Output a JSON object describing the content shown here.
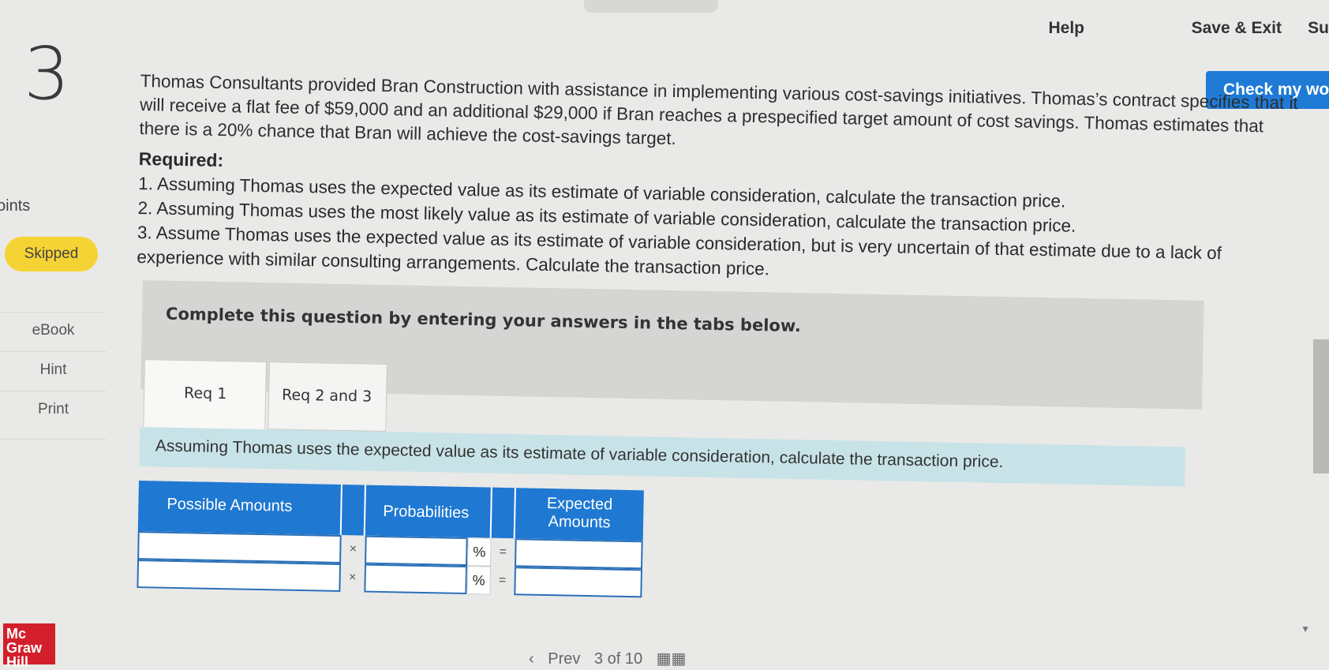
{
  "question_number": "3",
  "topnav": {
    "help": "Help",
    "save_exit": "Save & Exit",
    "submit_partial": "Su"
  },
  "check_button": "Check my wo",
  "sidebar": {
    "points_label": "oints",
    "status_badge": "Skipped",
    "links": [
      "eBook",
      "Hint",
      "Print"
    ]
  },
  "logo": {
    "line1": "Mc",
    "line2": "Graw",
    "line3": "Hill"
  },
  "question": {
    "text": "Thomas Consultants provided Bran Construction with assistance in implementing various cost-savings initiatives. Thomas’s contract specifies that it will receive a flat fee of $59,000 and an additional $29,000 if Bran reaches a prespecified target amount of cost savings. Thomas estimates that there is a 20% chance that Bran will achieve the cost-savings target.",
    "required_heading": "Required:",
    "requirements": [
      "1. Assuming Thomas uses the expected value as its estimate of variable consideration, calculate the transaction price.",
      "2. Assuming Thomas uses the most likely value as its estimate of variable consideration, calculate the transaction price.",
      "3. Assume Thomas uses the expected value as its estimate of variable consideration, but is very uncertain of that estimate due to a lack of experience with similar consulting arrangements. Calculate the transaction price."
    ]
  },
  "panel": {
    "title": "Complete this question by entering your answers in the tabs below.",
    "tabs": [
      "Req 1",
      "Req 2 and 3"
    ]
  },
  "instruction": "Assuming Thomas uses the expected value as its estimate of variable consideration, calculate the transaction price.",
  "table": {
    "headers": {
      "amounts": "Possible Amounts",
      "probabilities": "Probabilities",
      "expected": "Expected Amounts"
    },
    "operators": {
      "times": "×",
      "percent": "%",
      "equals": "="
    },
    "rows": [
      {
        "amount": "",
        "probability": "",
        "expected": ""
      },
      {
        "amount": "",
        "probability": "",
        "expected": ""
      }
    ]
  },
  "bottom_nav": {
    "prev": "Prev",
    "page_info": "3 of 10"
  },
  "colors": {
    "accent": "#1f78d1",
    "badge": "#f6d335",
    "instruction_bg": "#c8e3e8"
  }
}
